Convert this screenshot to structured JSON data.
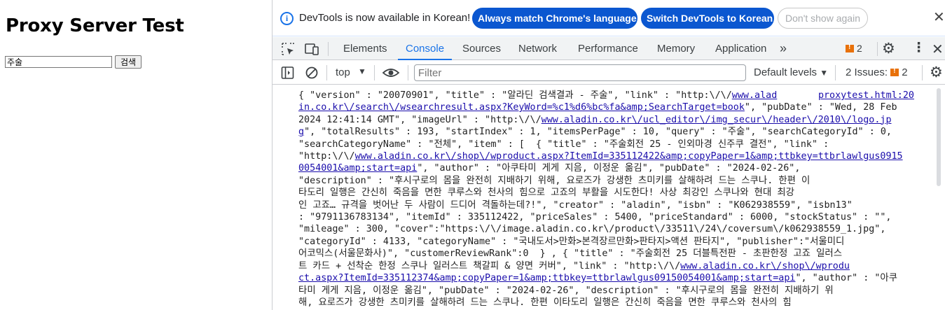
{
  "page": {
    "title": "Proxy Server Test",
    "search_value": "주술",
    "search_button": "검색"
  },
  "infobar": {
    "message": "DevTools is now available in Korean!",
    "btn_match": "Always match Chrome's language",
    "btn_switch": "Switch DevTools to Korean",
    "btn_dismiss": "Don't show again"
  },
  "tabs": [
    "Elements",
    "Console",
    "Sources",
    "Network",
    "Performance",
    "Memory",
    "Application"
  ],
  "active_tab": "Console",
  "issue_count": "2",
  "toolbar": {
    "context": "top",
    "filter_placeholder": "Filter",
    "levels": "Default levels",
    "issues_label": "2 Issues:",
    "issues_count": "2"
  },
  "console": {
    "source_link": "proxytest.html:20",
    "lines": [
      [
        {
          "t": "{ \"version\" : \"20070901\", \"title\" : \"알라딘 검색결과 - 주술\", \"link\" : \"http:\\/\\/"
        },
        {
          "t": "www.alad",
          "link": true
        }
      ],
      [
        {
          "t": "in.co.kr\\/search\\/wsearchresult.aspx?KeyWord=%c1%d6%bc%fa&amp;SearchTarget=book",
          "link": true
        },
        {
          "t": "\", \"pubDate\" : \"Wed, 28 Feb"
        }
      ],
      [
        {
          "t": "2024 12:41:14 GMT\", \"imageUrl\" : \"http:\\/\\/"
        },
        {
          "t": "www.aladin.co.kr\\/ucl_editor\\/img_secur\\/header\\/2010\\/logo.jp",
          "link": true
        }
      ],
      [
        {
          "t": "g",
          "link": true
        },
        {
          "t": "\", \"totalResults\" : 193, \"startIndex\" : 1, \"itemsPerPage\" : 10, \"query\" : \"주술\", \"searchCategoryId\" : 0,"
        }
      ],
      [
        {
          "t": "\"searchCategoryName\" : \"전체\", \"item\" : [  { \"title\" : \"주술회전 25 - 인외마경 신주쿠 결전\", \"link\" :"
        }
      ],
      [
        {
          "t": "\"http:\\/\\/"
        },
        {
          "t": "www.aladin.co.kr\\/shop\\/wproduct.aspx?ItemId=335112422&amp;copyPaper=1&amp;ttbkey=ttbrlawlgus0915",
          "link": true
        }
      ],
      [
        {
          "t": "0054001&amp;start=api",
          "link": true
        },
        {
          "t": "\", \"author\" : \"아쿠타미 게게 지음, 이정운 옮김\", \"pubDate\" : \"2024-02-26\","
        }
      ],
      [
        {
          "t": "\"description\" : \"후시구로의 몸을 완전히 지배하기 위해, 요로즈가 강생한 츠미키를 살해하려 드는 스쿠나. 한편 이"
        }
      ],
      [
        {
          "t": "타도리 일행은 간신히 죽음을 면한 쿠루스와 천사의 힘으로 고죠의 부활을 시도한다! 사상 최강인 스쿠나와 현대 최강"
        }
      ],
      [
        {
          "t": "인 고죠… 규격을 벗어난 두 사람이 드디어 격돌하는데?!\", \"creator\" : \"aladin\", \"isbn\" : \"K062938559\", \"isbn13\""
        }
      ],
      [
        {
          "t": ": \"9791136783134\", \"itemId\" : 335112422, \"priceSales\" : 5400, \"priceStandard\" : 6000, \"stockStatus\" : \"\","
        }
      ],
      [
        {
          "t": "\"mileage\" : 300, \"cover\":\"https:\\/\\/image.aladin.co.kr\\/product\\/33511\\/24\\/coversum\\/k062938559_1.jpg\","
        }
      ],
      [
        {
          "t": "\"categoryId\" : 4133, \"categoryName\" : \"국내도서>만화>본격장르만화>판타지>액션 판타지\", \"publisher\":\"서울미디"
        }
      ],
      [
        {
          "t": "어코믹스(서울문화사)\", \"customerReviewRank\":0  } , { \"title\" : \"주술회전 25 더블특전판 - 초판한정 고죠 일러스"
        }
      ],
      [
        {
          "t": "트 카드 + 선착순 한정 스쿠나 일러스트 책갈피 & 양면 커버\", \"link\" : \"http:\\/\\/"
        },
        {
          "t": "www.aladin.co.kr\\/shop\\/wprodu",
          "link": true
        }
      ],
      [
        {
          "t": "ct.aspx?ItemId=335112374&amp;copyPaper=1&amp;ttbkey=ttbrlawlgus09150054001&amp;start=api",
          "link": true
        },
        {
          "t": "\", \"author\" : \"아쿠"
        }
      ],
      [
        {
          "t": "타미 게게 지음, 이정운 옮김\", \"pubDate\" : \"2024-02-26\", \"description\" : \"후시구로의 몸을 완전히 지배하기 위"
        }
      ],
      [
        {
          "t": "해, 요로즈가 강생한 츠미키를 살해하려 드는 스쿠나. 한편 이타도리 일행은 간신히 죽음을 면한 쿠루스와 천사의 힘"
        }
      ]
    ]
  }
}
